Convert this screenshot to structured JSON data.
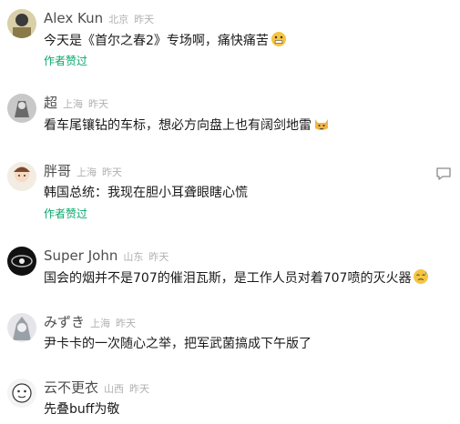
{
  "comments": [
    {
      "author": "Alex Kun",
      "location": "北京",
      "time": "昨天",
      "text": "今天是《首尔之春2》专场啊，痛快痛苦",
      "emoji": "grimace-emoji-icon",
      "badge": "作者赞过"
    },
    {
      "author": "超",
      "location": "上海",
      "time": "昨天",
      "text": "看车尾镶钻的车标，想必方向盘上也有阔剑地雷",
      "emoji": "cat-emoji-icon"
    },
    {
      "author": "胖哥",
      "location": "上海",
      "time": "昨天",
      "text": "韩国总统：我现在胆小耳聋眼瞎心慌",
      "badge": "作者赞过",
      "action_icon": "comment-reply-icon"
    },
    {
      "author": "Super John",
      "location": "山东",
      "time": "昨天",
      "text": "国会的烟并不是707的催泪瓦斯，是工作人员对着707喷的灭火器",
      "emoji": "sweat-emoji-icon"
    },
    {
      "author": "みずき",
      "location": "上海",
      "time": "昨天",
      "text": "尹卡卡的一次随心之举，把军武菌搞成下午版了"
    },
    {
      "author": "云不更衣",
      "location": "山西",
      "time": "昨天",
      "text": "先叠buff为敬"
    }
  ],
  "colors": {
    "author": "#4d4d4d",
    "meta": "#b0b0b0",
    "liked": "#07a86b",
    "text": "#1a1a1a"
  }
}
